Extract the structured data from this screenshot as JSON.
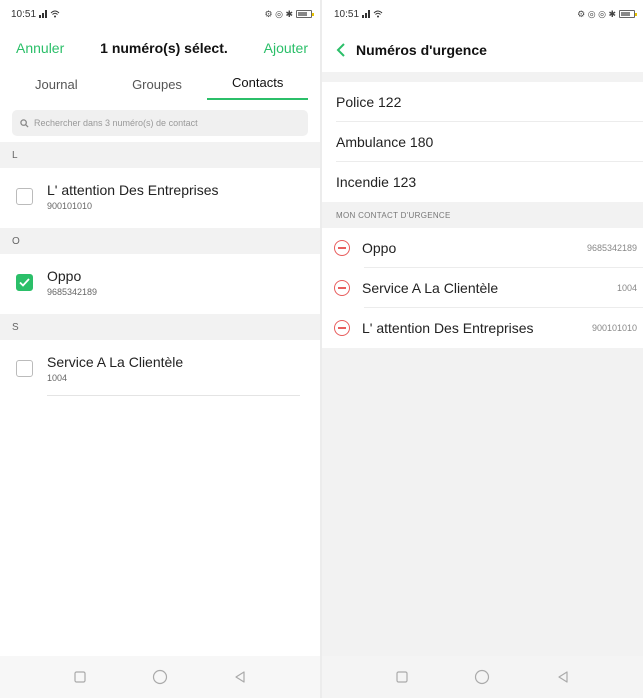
{
  "left": {
    "status": {
      "time": "10:51",
      "right_icons": "⚙ ◎ ✱"
    },
    "header": {
      "cancel": "Annuler",
      "title": "1 numéro(s) sélect.",
      "add": "Ajouter"
    },
    "tabs": [
      {
        "label": "Journal",
        "active": false
      },
      {
        "label": "Groupes",
        "active": false
      },
      {
        "label": "Contacts",
        "active": true
      }
    ],
    "search": {
      "placeholder": "Rechercher dans 3 numéro(s) de contact"
    },
    "sections": [
      {
        "letter": "L",
        "contacts": [
          {
            "name": "L' attention Des Entreprises",
            "number": "900101010",
            "checked": false
          }
        ]
      },
      {
        "letter": "O",
        "contacts": [
          {
            "name": "Oppo",
            "number": "9685342189",
            "checked": true
          }
        ]
      },
      {
        "letter": "S",
        "contacts": [
          {
            "name": "Service A La Clientèle",
            "number": "1004",
            "checked": false
          }
        ]
      }
    ]
  },
  "right": {
    "status": {
      "time": "10:51",
      "right_icons": "⚙ ◎ ◎ ✱"
    },
    "header": {
      "title": "Numéros d'urgence"
    },
    "emergency": [
      {
        "label": "Police 122"
      },
      {
        "label": "Ambulance 180"
      },
      {
        "label": "Incendie 123"
      }
    ],
    "section_label": "MON CONTACT D'URGENCE",
    "contacts": [
      {
        "name": "Oppo",
        "number": "9685342189"
      },
      {
        "name": "Service A La Clientèle",
        "number": "1004"
      },
      {
        "name": "L' attention Des Entreprises",
        "number": "900101010"
      }
    ]
  },
  "colors": {
    "accent": "#2bbf69",
    "danger": "#e85d5d"
  }
}
